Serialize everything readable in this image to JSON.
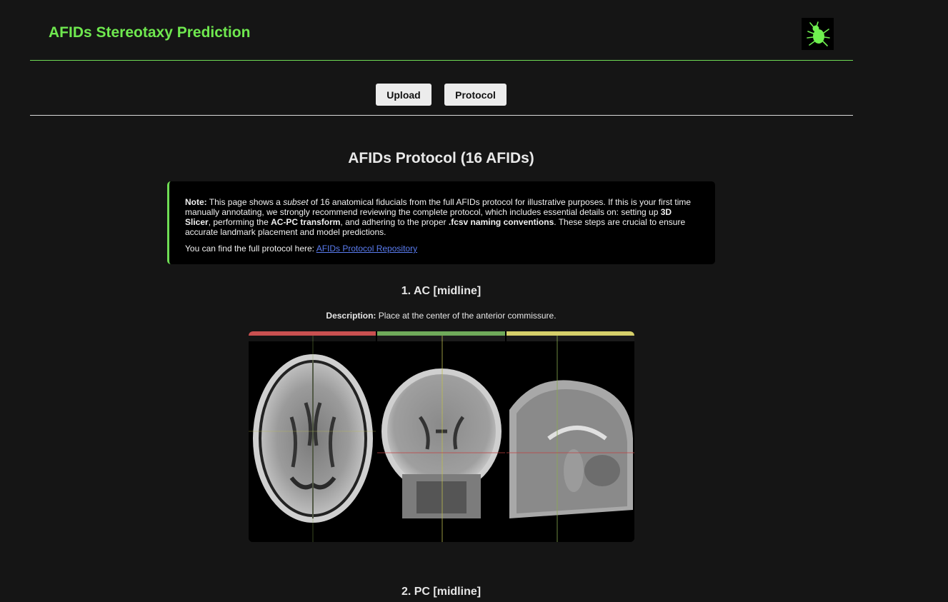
{
  "header": {
    "title": "AFIDs Stereotaxy Prediction",
    "logo_icon": "bug-icon",
    "accent_color": "#6fe84f"
  },
  "nav": {
    "upload_label": "Upload",
    "protocol_label": "Protocol"
  },
  "main": {
    "title": "AFIDs Protocol (16 AFIDs)",
    "note": {
      "label": "Note:",
      "t1": " This page shows a ",
      "t1_em": "subset",
      "t2": " of 16 anatomical fiducials from the full AFIDs protocol for illustrative purposes. If this is your first time manually annotating, we strongly recommend reviewing the complete protocol, which includes essential details on: setting up ",
      "b1": "3D Slicer",
      "t3": ", performing the ",
      "b2": "AC-PC transform",
      "t4": ", and adhering to the proper ",
      "b3": ".fcsv naming conventions",
      "t5": ". These steps are crucial to ensure accurate landmark placement and model predictions.",
      "link_prefix": "You can find the full protocol here: ",
      "link_text": "AFIDs Protocol Repository"
    },
    "afids": [
      {
        "heading": "1. AC [midline]",
        "desc_label": "Description:",
        "desc_text": " Place at the center of the anterior commissure."
      },
      {
        "heading": "2. PC [midline]"
      }
    ]
  }
}
